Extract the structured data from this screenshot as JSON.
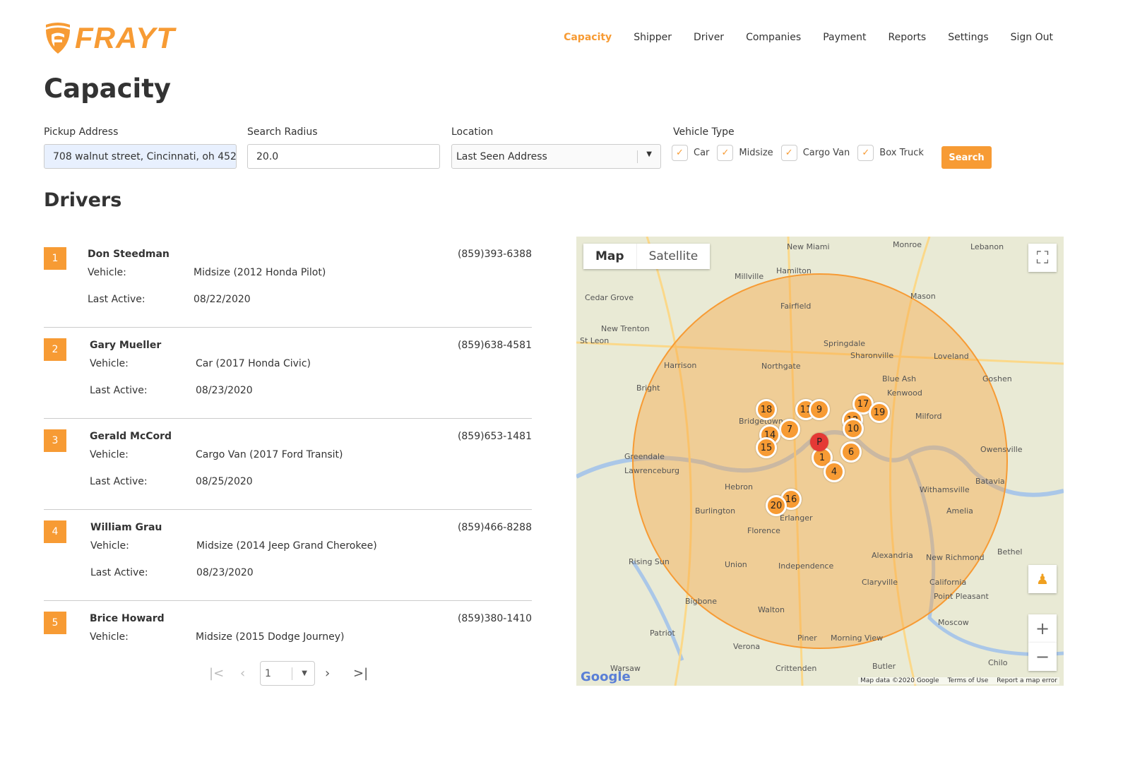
{
  "brand": {
    "name": "FRAYT",
    "color": "#f79b34"
  },
  "nav": [
    {
      "label": "Capacity",
      "active": true
    },
    {
      "label": "Shipper"
    },
    {
      "label": "Driver"
    },
    {
      "label": "Companies"
    },
    {
      "label": "Payment"
    },
    {
      "label": "Reports"
    },
    {
      "label": "Settings"
    },
    {
      "label": "Sign Out"
    }
  ],
  "page_title": "Capacity",
  "filters": {
    "pickup": {
      "label": "Pickup Address",
      "value": "708 walnut street, Cincinnati, oh 452"
    },
    "radius": {
      "label": "Search Radius",
      "value": "20.0"
    },
    "location": {
      "label": "Location",
      "value": "Last Seen Address"
    },
    "vehicle": {
      "label": "Vehicle Type",
      "options": [
        {
          "label": "Car",
          "checked": true
        },
        {
          "label": "Midsize",
          "checked": true
        },
        {
          "label": "Cargo Van",
          "checked": true
        },
        {
          "label": "Box Truck",
          "checked": true
        }
      ]
    },
    "search_label": "Search"
  },
  "drivers_title": "Drivers",
  "vehicle_key": "Vehicle:",
  "active_key": "Last Active:",
  "drivers": [
    {
      "num": "1",
      "name": "Don Steedman",
      "phone": "(859)393-6388",
      "vehicle": "Midsize (2012 Honda Pilot)",
      "last_active": "08/22/2020"
    },
    {
      "num": "2",
      "name": "Gary Mueller",
      "phone": "(859)638-4581",
      "vehicle": "Car (2017 Honda Civic)",
      "last_active": "08/23/2020"
    },
    {
      "num": "3",
      "name": "Gerald McCord",
      "phone": "(859)653-1481",
      "vehicle": "Cargo Van (2017 Ford Transit)",
      "last_active": "08/25/2020"
    },
    {
      "num": "4",
      "name": "William Grau",
      "phone": "(859)466-8288",
      "vehicle": "Midsize (2014 Jeep Grand Cherokee)",
      "last_active": "08/23/2020"
    },
    {
      "num": "5",
      "name": "Brice Howard",
      "phone": "(859)380-1410",
      "vehicle": "Midsize (2015 Dodge Journey)",
      "last_active": ""
    }
  ],
  "pager": {
    "page": "1"
  },
  "map": {
    "type_map": "Map",
    "type_satellite": "Satellite",
    "pickup_marker": "P",
    "markers": [
      "18",
      "11",
      "9",
      "17",
      "19",
      "12",
      "10",
      "7",
      "14",
      "15",
      "6",
      "1",
      "4",
      "16",
      "20"
    ],
    "places": [
      "New Miami",
      "Monroe",
      "Lebanon",
      "Hamilton",
      "Millville",
      "Cedar Grove",
      "Fairfield",
      "Mason",
      "New Trenton",
      "Springdale",
      "Sharonville",
      "St Leon",
      "Harrison",
      "Northgate",
      "Loveland",
      "Blue Ash",
      "Kenwood",
      "Bright",
      "Goshen",
      "Milford",
      "Bridgetown",
      "Greendale",
      "Lawrenceburg",
      "Owensville",
      "Hebron",
      "Batavia",
      "Burlington",
      "Erlanger",
      "Withamsville",
      "Florence",
      "Amelia",
      "Alexandria",
      "Rising Sun",
      "Union",
      "Independence",
      "Bethel",
      "New Richmond",
      "Claryville",
      "California",
      "Point Pleasant",
      "Bigbone",
      "Walton",
      "Moscow",
      "Patriot",
      "Piner",
      "Morning View",
      "Verona",
      "Crittenden",
      "Butler",
      "Chilo",
      "Warsaw"
    ],
    "attribution": [
      "Map data ©2020 Google",
      "Terms of Use",
      "Report a map error"
    ],
    "google": "Google",
    "radius_color": "#f7a440"
  }
}
